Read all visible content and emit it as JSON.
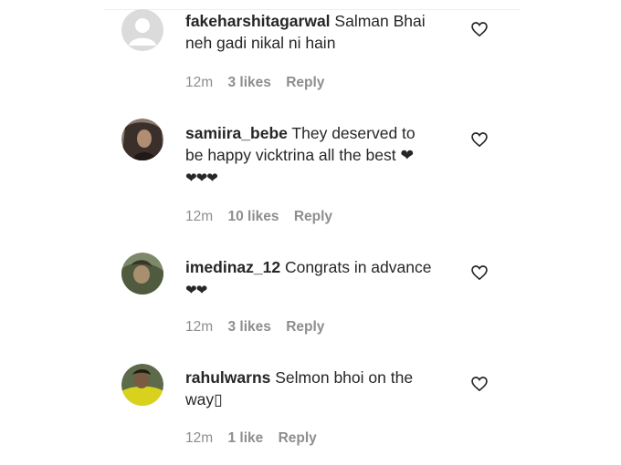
{
  "comments": [
    {
      "username": "fakeharshitagarwal",
      "line1": "Salman Bhai",
      "line2": "neh gadi nikal ni hain",
      "time": "12m",
      "likes": "3 likes",
      "reply": "Reply"
    },
    {
      "username": "samiira_bebe",
      "line1": "They deserved to",
      "line2": "be happy vicktrina all the best ❤",
      "line3": "❤❤❤",
      "time": "12m",
      "likes": "10 likes",
      "reply": "Reply"
    },
    {
      "username": "imedinaz_12",
      "line1": "Congrats in advance",
      "line2": "❤❤",
      "time": "12m",
      "likes": "3 likes",
      "reply": "Reply"
    },
    {
      "username": "rahulwarns",
      "line1": "Selmon bhoi on the",
      "line2": "way▯",
      "time": "12m",
      "likes": "1 like",
      "reply": "Reply"
    }
  ],
  "icons": {
    "like": "heart-outline-icon",
    "avatar_placeholder": "default-user-icon"
  },
  "colors": {
    "text": "#262626",
    "meta": "#8e8e8e"
  }
}
